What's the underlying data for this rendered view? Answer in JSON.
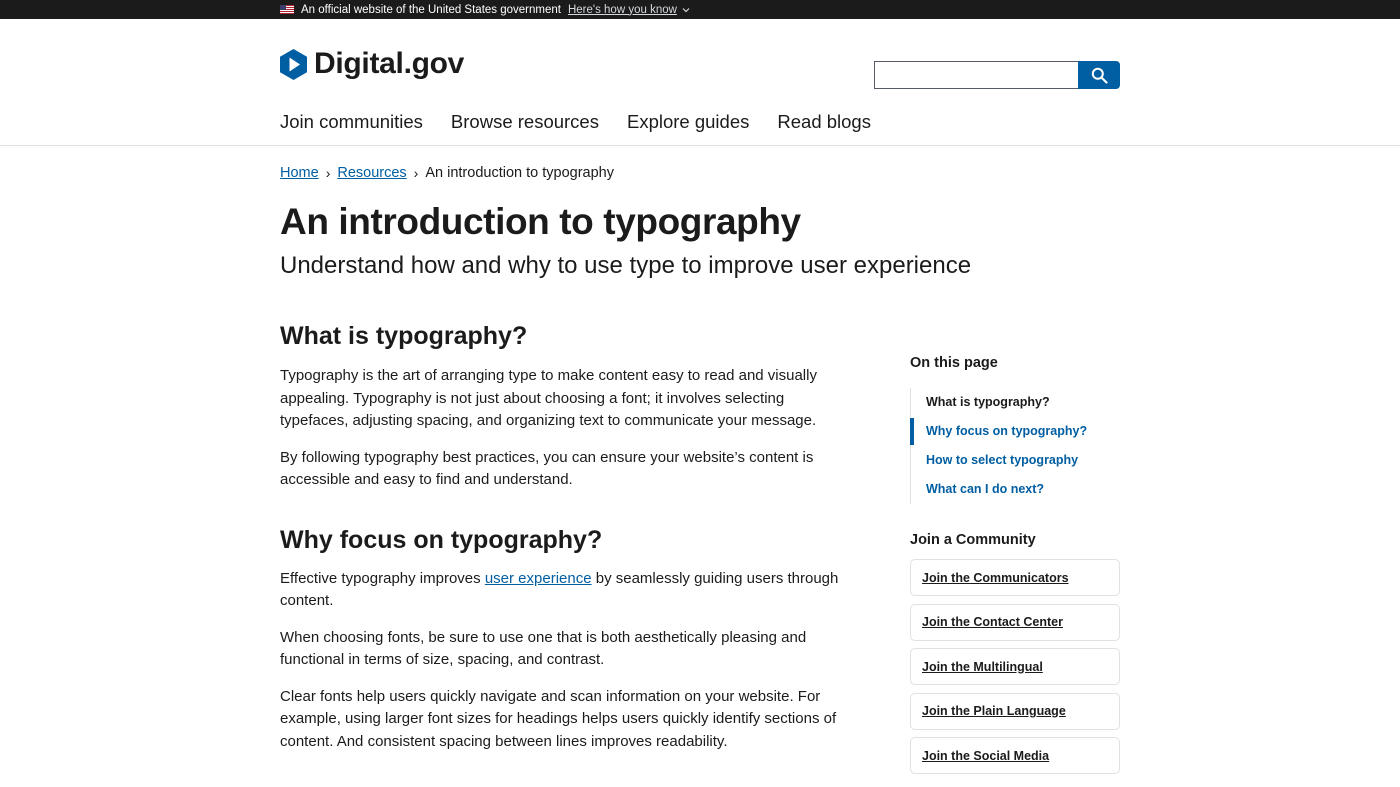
{
  "gov_banner": {
    "text": "An official website of the United States government",
    "link_label": "Here's how you know"
  },
  "header": {
    "logo_text": "Digital.gov",
    "search_placeholder": "",
    "nav": [
      {
        "label": "Join communities"
      },
      {
        "label": "Browse resources"
      },
      {
        "label": "Explore guides"
      },
      {
        "label": "Read blogs"
      }
    ]
  },
  "breadcrumb": {
    "items": [
      {
        "label": "Home"
      },
      {
        "label": "Resources"
      }
    ],
    "current": "An introduction to typography"
  },
  "page": {
    "title": "An introduction to typography",
    "subtitle": "Understand how and why to use type to improve user experience"
  },
  "content": {
    "section1": {
      "heading": "What is typography?",
      "p1": "Typography is the art of arranging type to make content easy to read and visually appealing. Typography is not just about choosing a font; it involves selecting typefaces, adjusting spacing, and organizing text to communicate your message.",
      "p2": "By following typography best practices, you can ensure your website’s content is accessible and easy to find and understand."
    },
    "section2": {
      "heading": "Why focus on typography?",
      "p1_before": "Effective typography improves ",
      "p1_link": "user experience",
      "p1_after": " by seamlessly guiding users through content.",
      "p2": "When choosing fonts, be sure to use one that is both aesthetically pleasing and functional in terms of size, spacing, and contrast.",
      "p3": "Clear fonts help users quickly navigate and scan information on your website. For example, using larger font sizes for headings helps users quickly identify sections of content. And consistent spacing between lines improves readability."
    }
  },
  "sidebar": {
    "heading": "On this page",
    "toc": [
      {
        "label": "What is typography?"
      },
      {
        "label": "Why focus on typography?"
      },
      {
        "label": "How to select typography"
      },
      {
        "label": "What can I do next?"
      }
    ],
    "community_heading": "Join a Community",
    "communities": [
      {
        "label": "Join the Communicators"
      },
      {
        "label": "Join the Contact Center"
      },
      {
        "label": "Join the Multilingual"
      },
      {
        "label": "Join the Plain Language"
      },
      {
        "label": "Join the Social Media"
      }
    ]
  },
  "colors": {
    "link_blue": "#005ea2",
    "banner_bg": "#1b1b1b",
    "text": "#1b1b1b",
    "border": "#dfe1e2"
  }
}
